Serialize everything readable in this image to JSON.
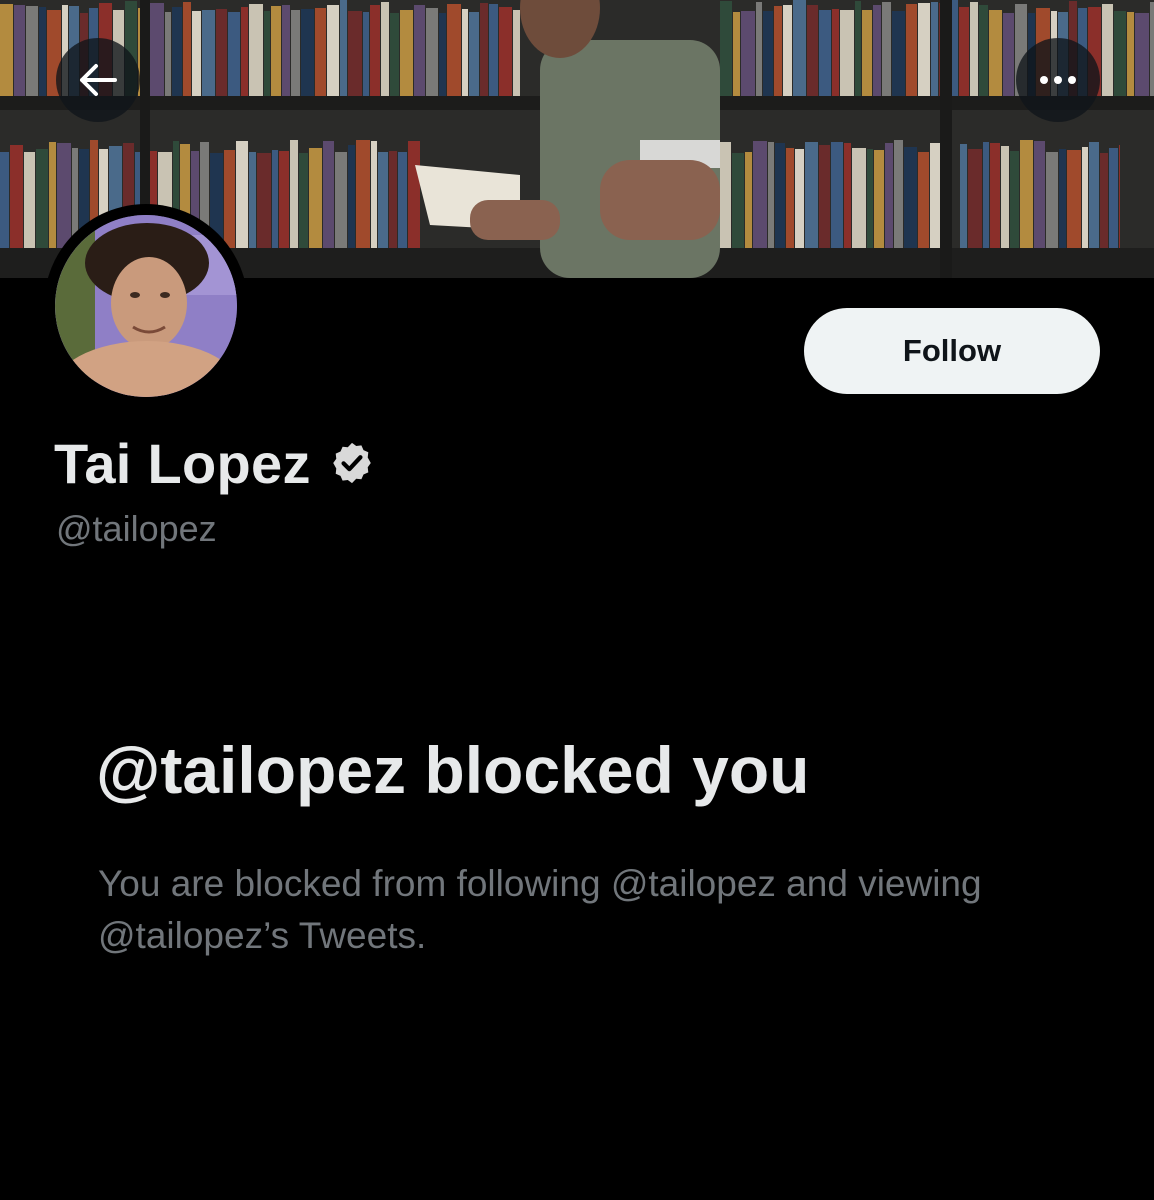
{
  "header": {
    "back_icon": "arrow-left-icon",
    "more_icon": "more-horizontal-icon"
  },
  "profile": {
    "display_name": "Tai Lopez",
    "verified_icon": "verified-badge-icon",
    "handle": "@tailopez",
    "follow_label": "Follow"
  },
  "blocked": {
    "title": "@tailopez blocked you",
    "description": "You are blocked from following @tailopez and viewing @tailopez’s Tweets."
  },
  "colors": {
    "background": "#000000",
    "primary_text": "#e7e9ea",
    "secondary_text": "#71767b",
    "follow_button_bg": "#eff3f4",
    "follow_button_text": "#0f1419"
  }
}
